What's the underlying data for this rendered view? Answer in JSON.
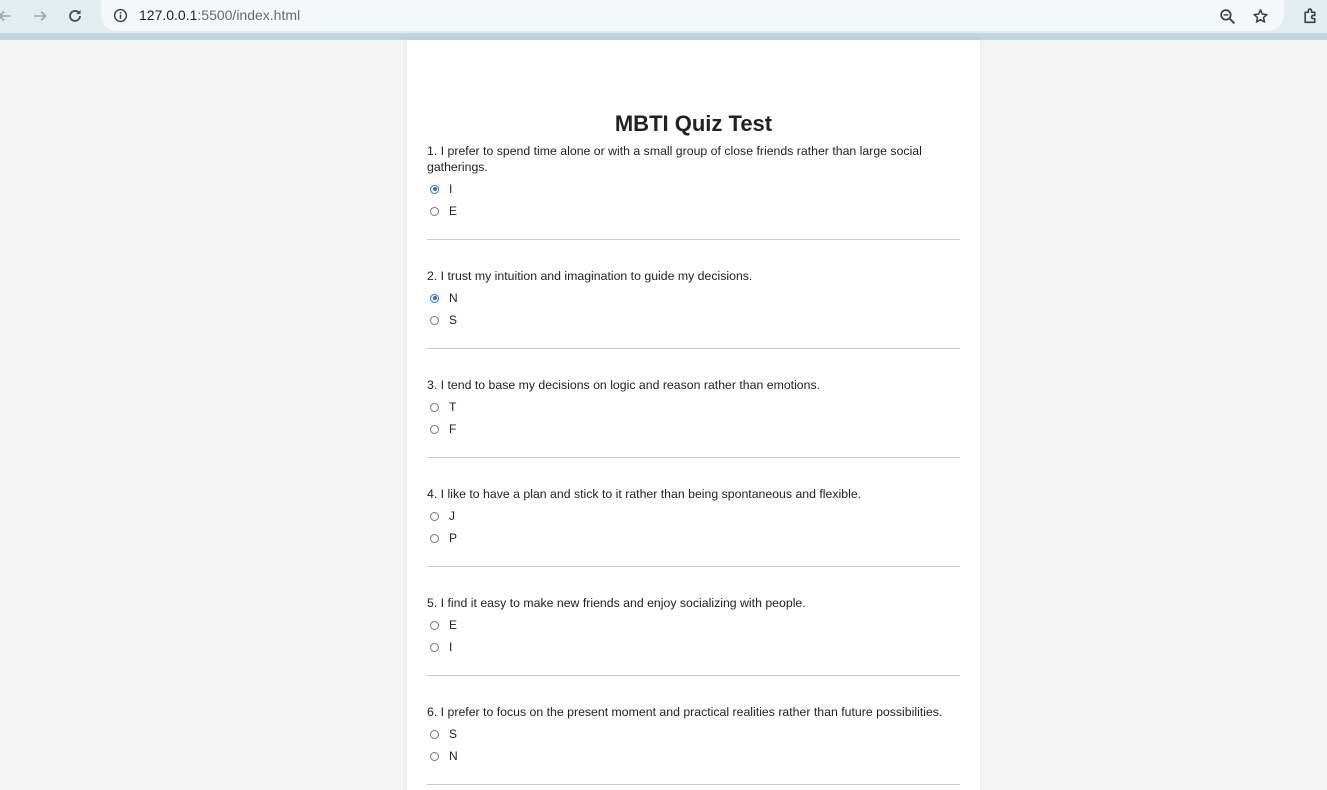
{
  "browser": {
    "url_host": "127.0.0.1",
    "url_rest": ":5500/index.html",
    "icons": [
      "back-arrow-icon",
      "forward-arrow-icon",
      "reload-icon",
      "site-info-icon",
      "zoom-icon",
      "bookmark-star-icon",
      "extensions-icon"
    ]
  },
  "colors": {
    "accent": "#1a73e8",
    "page_bg": "#f5f5f5",
    "toolbar_bg": "#e3eef0"
  },
  "quiz": {
    "title": "MBTI Quiz Test",
    "questions": [
      {
        "text": "1. I prefer to spend time alone or with a small group of close friends rather than large social gatherings.",
        "options": [
          {
            "label": "I",
            "checked": true
          },
          {
            "label": "E",
            "checked": false
          }
        ]
      },
      {
        "text": "2. I trust my intuition and imagination to guide my decisions.",
        "options": [
          {
            "label": "N",
            "checked": true
          },
          {
            "label": "S",
            "checked": false
          }
        ]
      },
      {
        "text": "3. I tend to base my decisions on logic and reason rather than emotions.",
        "options": [
          {
            "label": "T",
            "checked": false
          },
          {
            "label": "F",
            "checked": false
          }
        ]
      },
      {
        "text": "4. I like to have a plan and stick to it rather than being spontaneous and flexible.",
        "options": [
          {
            "label": "J",
            "checked": false
          },
          {
            "label": "P",
            "checked": false
          }
        ]
      },
      {
        "text": "5. I find it easy to make new friends and enjoy socializing with people.",
        "options": [
          {
            "label": "E",
            "checked": false
          },
          {
            "label": "I",
            "checked": false
          }
        ]
      },
      {
        "text": "6. I prefer to focus on the present moment and practical realities rather than future possibilities.",
        "options": [
          {
            "label": "S",
            "checked": false
          },
          {
            "label": "N",
            "checked": false
          }
        ]
      }
    ]
  }
}
